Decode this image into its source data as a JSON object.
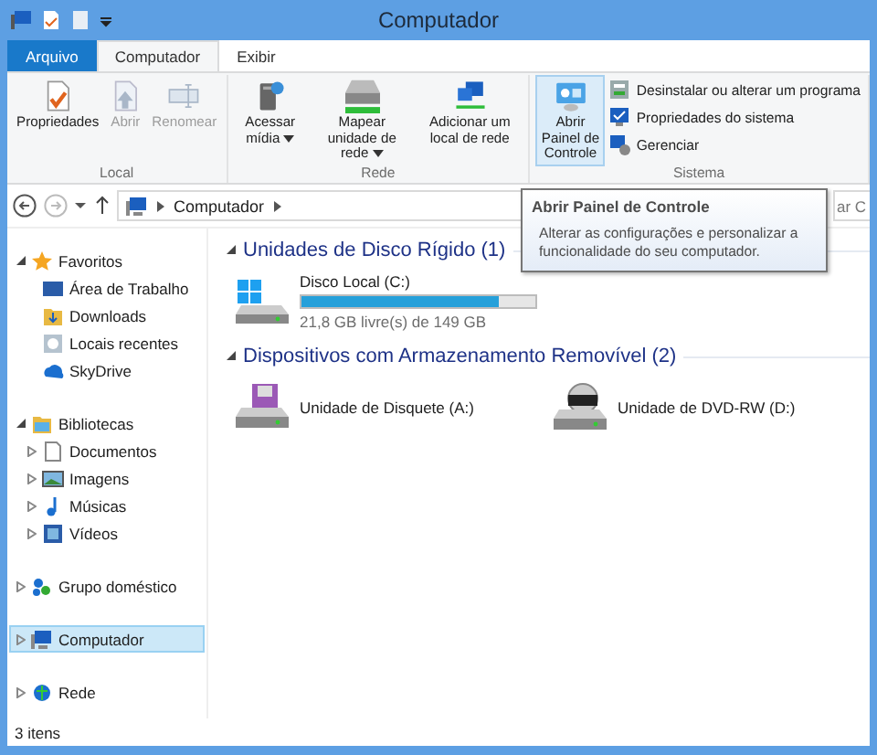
{
  "window": {
    "title": "Computador"
  },
  "ribbon_tabs": [
    {
      "label": "Arquivo",
      "kind": "file",
      "selected": false
    },
    {
      "label": "Computador",
      "kind": "tab",
      "selected": true
    },
    {
      "label": "Exibir",
      "kind": "tab",
      "selected": false
    }
  ],
  "ribbon_groups": [
    {
      "label": "Local",
      "buttons": [
        {
          "label": "Propriedades",
          "disabled": false,
          "dropdown": false
        },
        {
          "label": "Abrir",
          "disabled": true,
          "dropdown": false
        },
        {
          "label": "Renomear",
          "disabled": true,
          "dropdown": false
        }
      ]
    },
    {
      "label": "Rede",
      "buttons": [
        {
          "label": "Acessar mídia",
          "disabled": false,
          "dropdown": true
        },
        {
          "label": "Mapear unidade de rede",
          "disabled": false,
          "dropdown": true
        },
        {
          "label": "Adicionar um local de rede",
          "disabled": false,
          "dropdown": false
        }
      ]
    },
    {
      "label": "Sistema",
      "buttons": [
        {
          "label": "Abrir Painel de Controle",
          "disabled": false,
          "dropdown": false,
          "hovered": true
        }
      ],
      "small_buttons": [
        {
          "label": "Desinstalar ou alterar um programa"
        },
        {
          "label": "Propriedades do sistema"
        },
        {
          "label": "Gerenciar"
        }
      ]
    }
  ],
  "address": {
    "crumbs": [
      "Computador"
    ]
  },
  "search": {
    "placeholder": "ar C"
  },
  "tooltip": {
    "title": "Abrir Painel de Controle",
    "text": "Alterar as configurações e personalizar a funcionalidade do seu computador."
  },
  "nav": [
    {
      "label": "Favoritos",
      "expanded": true,
      "selected": false,
      "children": [
        {
          "label": "Área de Trabalho",
          "selected": false
        },
        {
          "label": "Downloads",
          "selected": false
        },
        {
          "label": "Locais recentes",
          "selected": false
        },
        {
          "label": "SkyDrive",
          "selected": false
        }
      ]
    },
    {
      "label": "Bibliotecas",
      "expanded": true,
      "selected": false,
      "children": [
        {
          "label": "Documentos",
          "expanded": false,
          "selected": false
        },
        {
          "label": "Imagens",
          "expanded": false,
          "selected": false
        },
        {
          "label": "Músicas",
          "expanded": false,
          "selected": false
        },
        {
          "label": "Vídeos",
          "expanded": false,
          "selected": false
        }
      ]
    },
    {
      "label": "Grupo doméstico",
      "expanded": false,
      "selected": false
    },
    {
      "label": "Computador",
      "expanded": false,
      "selected": true
    },
    {
      "label": "Rede",
      "expanded": false,
      "selected": false
    }
  ],
  "sections": [
    {
      "title": "Unidades de Disco Rígido (1)",
      "expanded": true,
      "drives": [
        {
          "name": "Disco Local (C:)",
          "level": 0.845,
          "free": "21,8 GB livre(s) de 149 GB"
        }
      ]
    },
    {
      "title": "Dispositivos com Armazenamento Removível (2)",
      "expanded": true,
      "drives": [
        {
          "name": "Unidade de Disquete (A:)"
        },
        {
          "name": "Unidade de DVD-RW (D:)"
        }
      ]
    }
  ],
  "status_bar": {
    "count": "3 itens"
  }
}
